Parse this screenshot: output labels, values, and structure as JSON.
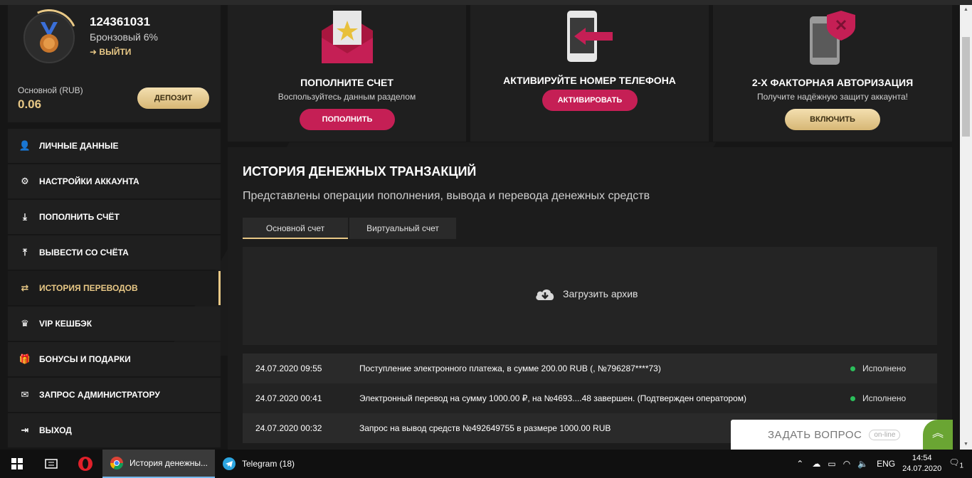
{
  "profile": {
    "user_id": "124361031",
    "level": "Бронзовый 6%",
    "logout_label": "ВЫЙТИ",
    "balance_label": "Основной (RUB)",
    "balance_value": "0.06",
    "deposit_label": "ДЕПОЗИТ"
  },
  "menu": [
    {
      "label": "ЛИЧНЫЕ ДАННЫЕ",
      "icon": "user-plus-icon"
    },
    {
      "label": "НАСТРОЙКИ АККАУНТА",
      "icon": "gears-icon"
    },
    {
      "label": "ПОПОЛНИТЬ СЧЁТ",
      "icon": "download-icon"
    },
    {
      "label": "ВЫВЕСТИ СО СЧЁТА",
      "icon": "upload-icon"
    },
    {
      "label": "ИСТОРИЯ ПЕРЕВОДОВ",
      "icon": "exchange-icon",
      "active": true
    },
    {
      "label": "VIP КЕШБЭК",
      "icon": "crown-icon"
    },
    {
      "label": "БОНУСЫ И ПОДАРКИ",
      "icon": "gift-icon"
    },
    {
      "label": "ЗАПРОС АДМИНИСТРАТОРУ",
      "icon": "envelope-icon"
    },
    {
      "label": "ВЫХОД",
      "icon": "sign-out-icon"
    }
  ],
  "cards": [
    {
      "title": "ПОПОЛНИТЕ СЧЕТ",
      "subtitle": "Воспользуйтесь данным разделом",
      "button": "ПОПОЛНИТЬ",
      "icon": "envelope-star-icon"
    },
    {
      "title": "АКТИВИРУЙТЕ НОМЕР ТЕЛЕФОНА",
      "subtitle": "",
      "button": "АКТИВИРОВАТЬ",
      "icon": "phone-arrow-icon"
    },
    {
      "title": "2-Х ФАКТОРНАЯ АВТОРИЗАЦИЯ",
      "subtitle": "Получите надёжную защиту аккаунта!",
      "button": "ВКЛЮЧИТЬ",
      "icon": "phone-shield-icon"
    }
  ],
  "history": {
    "title": "ИСТОРИЯ ДЕНЕЖНЫХ ТРАНЗАКЦИЙ",
    "subtitle": "Представлены операции пополнения, вывода и перевода денежных средств",
    "tabs": [
      "Основной счет",
      "Виртуальный счет"
    ],
    "archive_label": "Загрузить архив",
    "rows": [
      {
        "date": "24.07.2020 09:55",
        "text": "Поступление электронного платежа, в сумме 200.00 RUB (, №796287****73)",
        "status": "Исполнено"
      },
      {
        "date": "24.07.2020 00:41",
        "text": "Электронный перевод на сумму 1000.00 ₽, на №4693....48 завершен. (Подтвержден оператором)",
        "status": "Исполнено"
      },
      {
        "date": "24.07.2020 00:32",
        "text": "Запрос на вывод средств №492649755 в размере 1000.00 RUB",
        "status": ""
      }
    ]
  },
  "chat": {
    "label": "ЗАДАТЬ ВОПРОС",
    "status": "on-line"
  },
  "taskbar": {
    "browser_tab": "История денежны...",
    "telegram": "Telegram (18)",
    "lang": "ENG",
    "time": "14:54",
    "date": "24.07.2020",
    "notif_count": "1"
  },
  "colors": {
    "gold": "#e8c886",
    "red": "#c51f55",
    "status_green": "#2bbf5b"
  }
}
